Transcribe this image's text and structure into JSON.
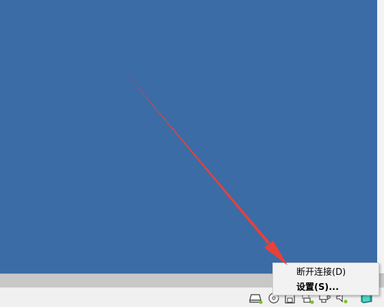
{
  "menu": {
    "items": [
      {
        "label": "断开连接(D)"
      },
      {
        "label": "设置(S)..."
      }
    ]
  },
  "statusbar": {
    "icons": [
      "hard-disk-icon",
      "optical-drive-icon",
      "floppy-icon",
      "network-icon",
      "usb-icon",
      "audio-icon",
      "vm-screen-icon"
    ]
  },
  "colors": {
    "desktop": "#3b6ca6",
    "arrow": "#e8413a",
    "activity_led": "#7bc61e"
  }
}
